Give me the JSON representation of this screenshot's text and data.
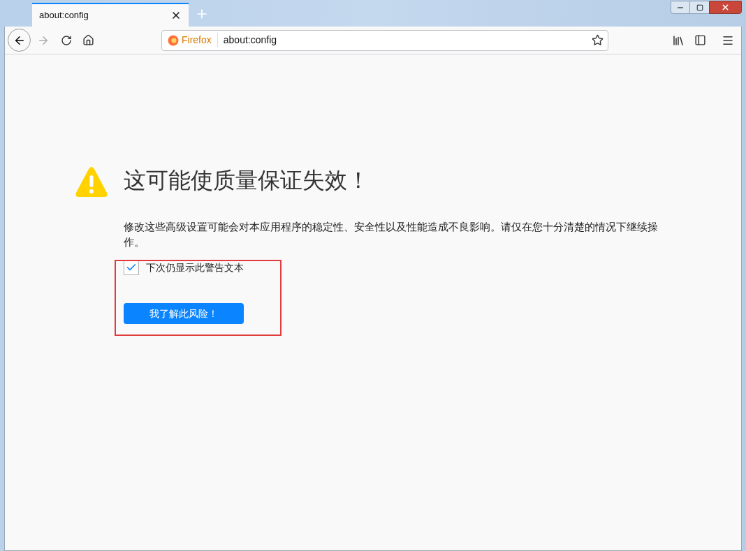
{
  "tabs": [
    {
      "title": "about:config",
      "selected": true
    }
  ],
  "address_bar": {
    "identity": "Firefox",
    "url": "about:config"
  },
  "warning": {
    "title": "这可能使质量保证失效！",
    "message": "修改这些高级设置可能会对本应用程序的稳定性、安全性以及性能造成不良影响。请仅在您十分清楚的情况下继续操作。",
    "checkbox": {
      "label": "下次仍显示此警告文本",
      "checked": true
    },
    "button": "我了解此风险！"
  }
}
